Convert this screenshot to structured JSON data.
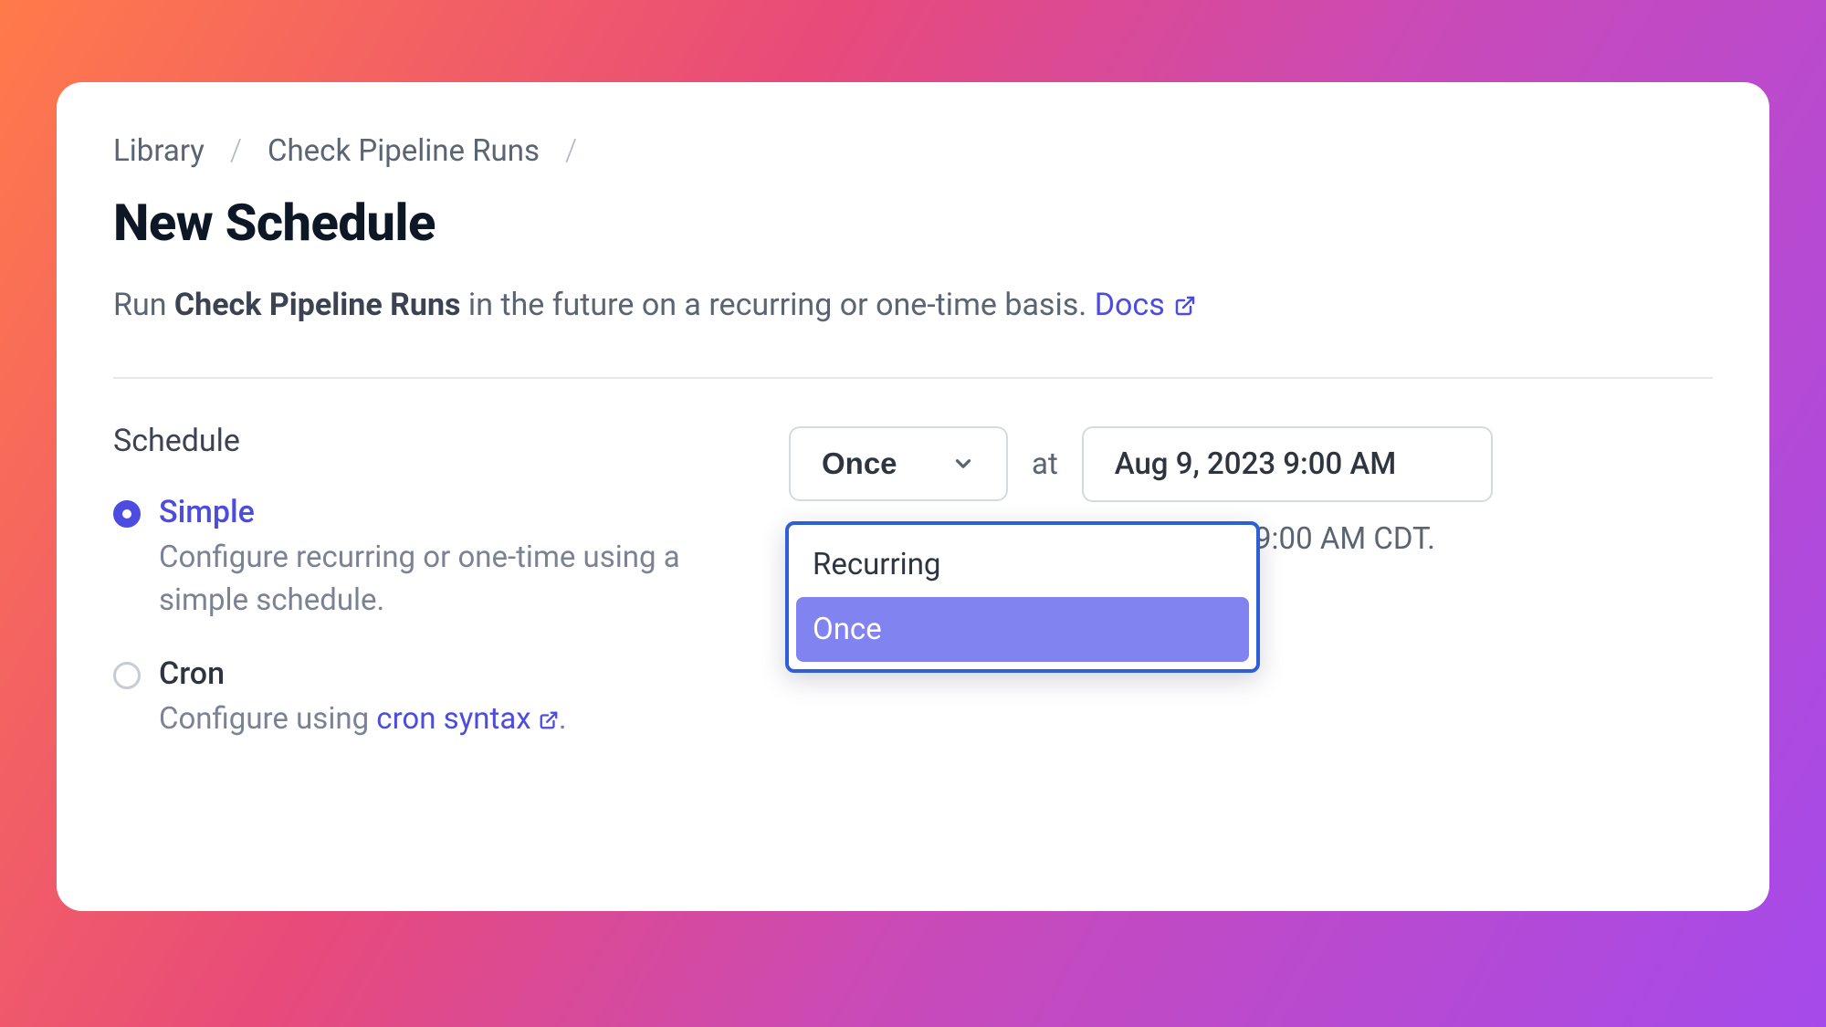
{
  "breadcrumb": {
    "item0": "Library",
    "item1": "Check Pipeline Runs"
  },
  "page": {
    "title": "New Schedule",
    "subtitle_prefix": "Run ",
    "subtitle_bold": "Check Pipeline Runs",
    "subtitle_suffix": " in the future on a recurring or one-time basis. ",
    "docs_label": "Docs"
  },
  "schedule": {
    "section_label": "Schedule",
    "options": {
      "simple": {
        "title": "Simple",
        "desc": "Configure recurring or one-time using a simple schedule."
      },
      "cron": {
        "title": "Cron",
        "desc_prefix": "Configure using ",
        "desc_link": "cron syntax",
        "desc_suffix": "."
      }
    },
    "selected_option": "simple"
  },
  "frequency": {
    "selected": "Once",
    "options": {
      "recurring": "Recurring",
      "once": "Once"
    },
    "at_label": "at",
    "datetime_value": "Aug 9, 2023 9:00 AM",
    "next_run_fragment": "  9:00 AM CDT."
  }
}
